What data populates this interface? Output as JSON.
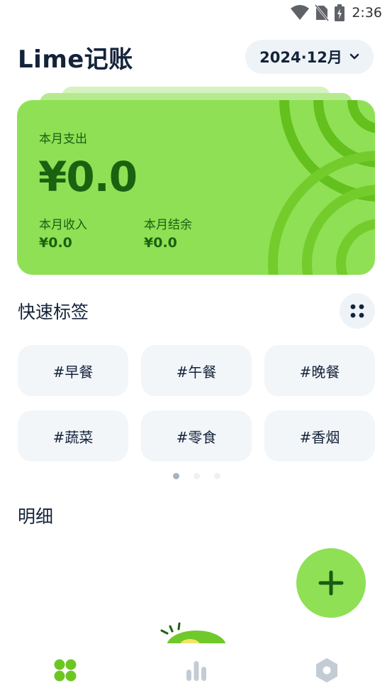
{
  "status_bar": {
    "time": "2:36",
    "icons": [
      "wifi-icon",
      "no-sim-icon",
      "battery-charging-icon"
    ]
  },
  "header": {
    "app_title": "Lime记账",
    "month": "2024·12月"
  },
  "summary_card": {
    "expense_label": "本月支出",
    "expense_value": "¥0.0",
    "income_label": "本月收入",
    "income_value": "¥0.0",
    "balance_label": "本月结余",
    "balance_value": "¥0.0"
  },
  "quick_tags": {
    "title": "快速标签",
    "tags": [
      "#早餐",
      "#午餐",
      "#晚餐",
      "#蔬菜",
      "#零食",
      "#香烟"
    ],
    "page_count": 3,
    "active_page": 0
  },
  "details": {
    "title": "明细"
  },
  "bottom_nav": {
    "items": [
      "home-grid-icon",
      "stats-bar-icon",
      "settings-hexagon-icon"
    ],
    "active": 0
  },
  "colors": {
    "accent": "#8fe055",
    "accent_dark": "#1a6210",
    "text": "#14233a",
    "chip_bg": "#f2f6f9"
  }
}
